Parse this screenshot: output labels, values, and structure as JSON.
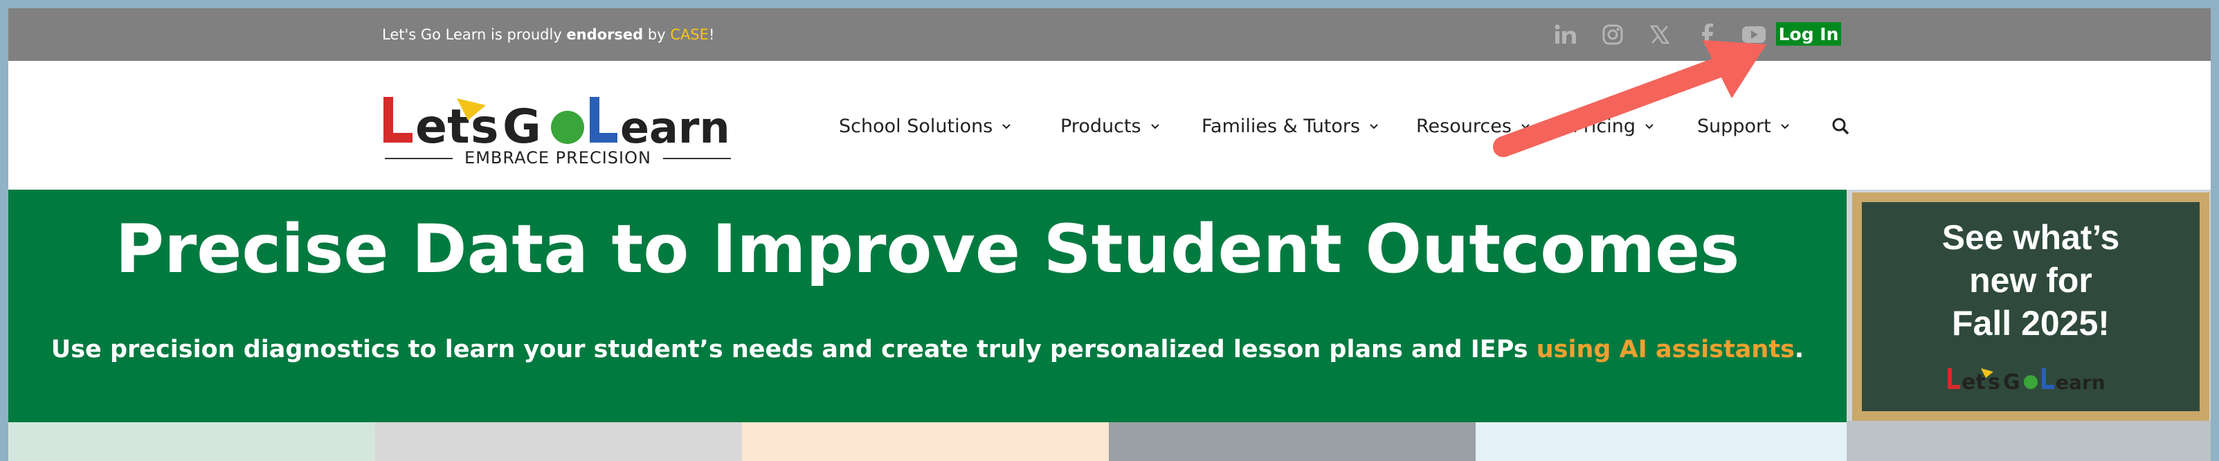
{
  "topbar": {
    "endorse_prefix": "Let's Go Learn is proudly ",
    "endorse_bold": "endorsed",
    "endorse_by": " by ",
    "endorse_org": "CASE",
    "endorse_suffix": "!",
    "social": [
      "linkedin-icon",
      "instagram-icon",
      "x-icon",
      "facebook-icon",
      "youtube-icon"
    ],
    "login_label": "Log In"
  },
  "logo": {
    "text": "Let's Go Learn",
    "tagline": "EMBRACE PRECISION"
  },
  "nav": {
    "items": [
      "School Solutions",
      "Products",
      "Families & Tutors",
      "Resources",
      "Pricing",
      "Support"
    ]
  },
  "hero": {
    "title": "Precise Data to Improve Student Outcomes",
    "subtitle_main": "Use precision diagnostics to learn your student’s needs and create truly personalized lesson plans and IEPs ",
    "subtitle_link": "using AI assistants",
    "subtitle_end": "."
  },
  "promo": {
    "line1": "See what’s",
    "line2": "new for",
    "line3": "Fall 2025!"
  },
  "colors": {
    "topbar": "#808080",
    "hero": "#017a40",
    "login": "#008a1e",
    "accent": "#f0a030",
    "arrow": "#f4645a"
  }
}
